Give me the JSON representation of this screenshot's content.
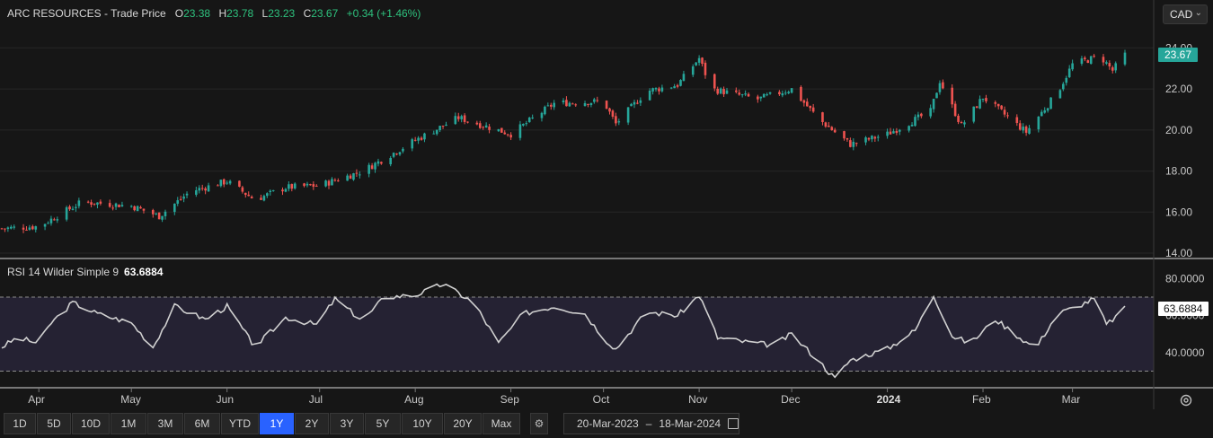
{
  "header": {
    "title": "ARC RESOURCES - Trade Price",
    "o_label": "O",
    "o_value": "23.38",
    "h_label": "H",
    "h_value": "23.78",
    "l_label": "L",
    "l_value": "23.23",
    "c_label": "C",
    "c_value": "23.67",
    "change": "+0.34 (+1.46%)"
  },
  "currency": {
    "selected": "CAD",
    "icon": "chevron-down-icon"
  },
  "colors": {
    "up": "#26a69a",
    "down": "#ef5350",
    "rsi_line": "#d0d0d0",
    "rsi_band": "#252233",
    "active": "#2962ff"
  },
  "chart_data": [
    {
      "type": "candlestick",
      "title": "ARC RESOURCES - Trade Price",
      "ylim": [
        14,
        24.5
      ],
      "yticks": [
        "14.00",
        "16.00",
        "18.00",
        "20.00",
        "22.00",
        "24.00"
      ],
      "last_price": "23.67",
      "x_tick_labels": [
        "Apr",
        "May",
        "Jun",
        "Jul",
        "Aug",
        "Sep",
        "Oct",
        "Nov",
        "Dec",
        "2024",
        "Feb",
        "Mar"
      ],
      "close_anchors": [
        [
          "2023-03-20",
          15.2
        ],
        [
          "2023-04-01",
          15.3
        ],
        [
          "2023-04-15",
          16.5
        ],
        [
          "2023-05-01",
          16.3
        ],
        [
          "2023-05-10",
          15.8
        ],
        [
          "2023-05-20",
          17.0
        ],
        [
          "2023-06-01",
          17.5
        ],
        [
          "2023-06-10",
          16.6
        ],
        [
          "2023-06-20",
          17.2
        ],
        [
          "2023-07-01",
          17.3
        ],
        [
          "2023-07-15",
          18.0
        ],
        [
          "2023-08-01",
          19.5
        ],
        [
          "2023-08-15",
          20.6
        ],
        [
          "2023-09-01",
          19.8
        ],
        [
          "2023-09-15",
          21.3
        ],
        [
          "2023-10-01",
          21.4
        ],
        [
          "2023-10-05",
          20.3
        ],
        [
          "2023-10-15",
          21.9
        ],
        [
          "2023-10-25",
          22.2
        ],
        [
          "2023-11-01",
          23.5
        ],
        [
          "2023-11-05",
          22.0
        ],
        [
          "2023-11-20",
          21.5
        ],
        [
          "2023-12-01",
          22.0
        ],
        [
          "2023-12-10",
          20.5
        ],
        [
          "2023-12-20",
          19.3
        ],
        [
          "2024-01-01",
          19.8
        ],
        [
          "2024-01-15",
          20.9
        ],
        [
          "2024-01-18",
          22.4
        ],
        [
          "2024-01-25",
          20.2
        ],
        [
          "2024-02-01",
          21.6
        ],
        [
          "2024-02-15",
          19.9
        ],
        [
          "2024-02-25",
          21.8
        ],
        [
          "2024-03-01",
          23.2
        ],
        [
          "2024-03-10",
          23.6
        ],
        [
          "2024-03-14",
          22.9
        ],
        [
          "2024-03-18",
          23.67
        ]
      ]
    },
    {
      "type": "line",
      "title": "RSI 14 Wilder Simple 9",
      "current_value": "63.6884",
      "ylim": [
        22,
        85
      ],
      "yticks": [
        "40.0000",
        "60.0000",
        "80.0000"
      ],
      "bands": [
        30,
        70
      ],
      "anchors": [
        [
          "2023-03-20",
          43
        ],
        [
          "2023-03-25",
          48
        ],
        [
          "2023-04-01",
          45
        ],
        [
          "2023-04-05",
          56
        ],
        [
          "2023-04-12",
          67
        ],
        [
          "2023-04-20",
          61
        ],
        [
          "2023-05-01",
          56
        ],
        [
          "2023-05-08",
          43
        ],
        [
          "2023-05-15",
          65
        ],
        [
          "2023-05-25",
          58
        ],
        [
          "2023-06-01",
          65
        ],
        [
          "2023-06-10",
          43
        ],
        [
          "2023-06-20",
          59
        ],
        [
          "2023-06-30",
          55
        ],
        [
          "2023-07-06",
          69
        ],
        [
          "2023-07-15",
          57
        ],
        [
          "2023-07-22",
          70
        ],
        [
          "2023-08-01",
          71
        ],
        [
          "2023-08-10",
          77
        ],
        [
          "2023-08-20",
          67
        ],
        [
          "2023-08-28",
          45
        ],
        [
          "2023-09-05",
          61
        ],
        [
          "2023-09-15",
          65
        ],
        [
          "2023-09-25",
          61
        ],
        [
          "2023-10-01",
          48
        ],
        [
          "2023-10-05",
          42
        ],
        [
          "2023-10-15",
          62
        ],
        [
          "2023-10-25",
          60
        ],
        [
          "2023-11-01",
          71
        ],
        [
          "2023-11-07",
          48
        ],
        [
          "2023-11-15",
          46
        ],
        [
          "2023-11-25",
          44
        ],
        [
          "2023-12-01",
          50
        ],
        [
          "2023-12-10",
          35
        ],
        [
          "2023-12-15",
          26
        ],
        [
          "2023-12-20",
          36
        ],
        [
          "2024-01-01",
          42
        ],
        [
          "2024-01-10",
          52
        ],
        [
          "2024-01-16",
          71
        ],
        [
          "2024-01-22",
          49
        ],
        [
          "2024-01-28",
          45
        ],
        [
          "2024-02-05",
          58
        ],
        [
          "2024-02-18",
          42
        ],
        [
          "2024-02-25",
          61
        ],
        [
          "2024-03-01",
          64
        ],
        [
          "2024-03-08",
          69
        ],
        [
          "2024-03-12",
          55
        ],
        [
          "2024-03-18",
          63.69
        ]
      ]
    }
  ],
  "toolbar": {
    "ranges": [
      {
        "label": "1D"
      },
      {
        "label": "5D"
      },
      {
        "label": "10D"
      },
      {
        "label": "1M"
      },
      {
        "label": "3M"
      },
      {
        "label": "6M"
      },
      {
        "label": "YTD"
      },
      {
        "label": "1Y",
        "active": true
      },
      {
        "label": "2Y"
      },
      {
        "label": "3Y"
      },
      {
        "label": "5Y"
      },
      {
        "label": "10Y"
      },
      {
        "label": "20Y"
      },
      {
        "label": "Max"
      }
    ],
    "settings_icon": "gear-icon"
  },
  "date_range": {
    "from": "20-Mar-2023",
    "separator": "–",
    "to": "18-Mar-2024",
    "icon": "calendar-icon"
  }
}
